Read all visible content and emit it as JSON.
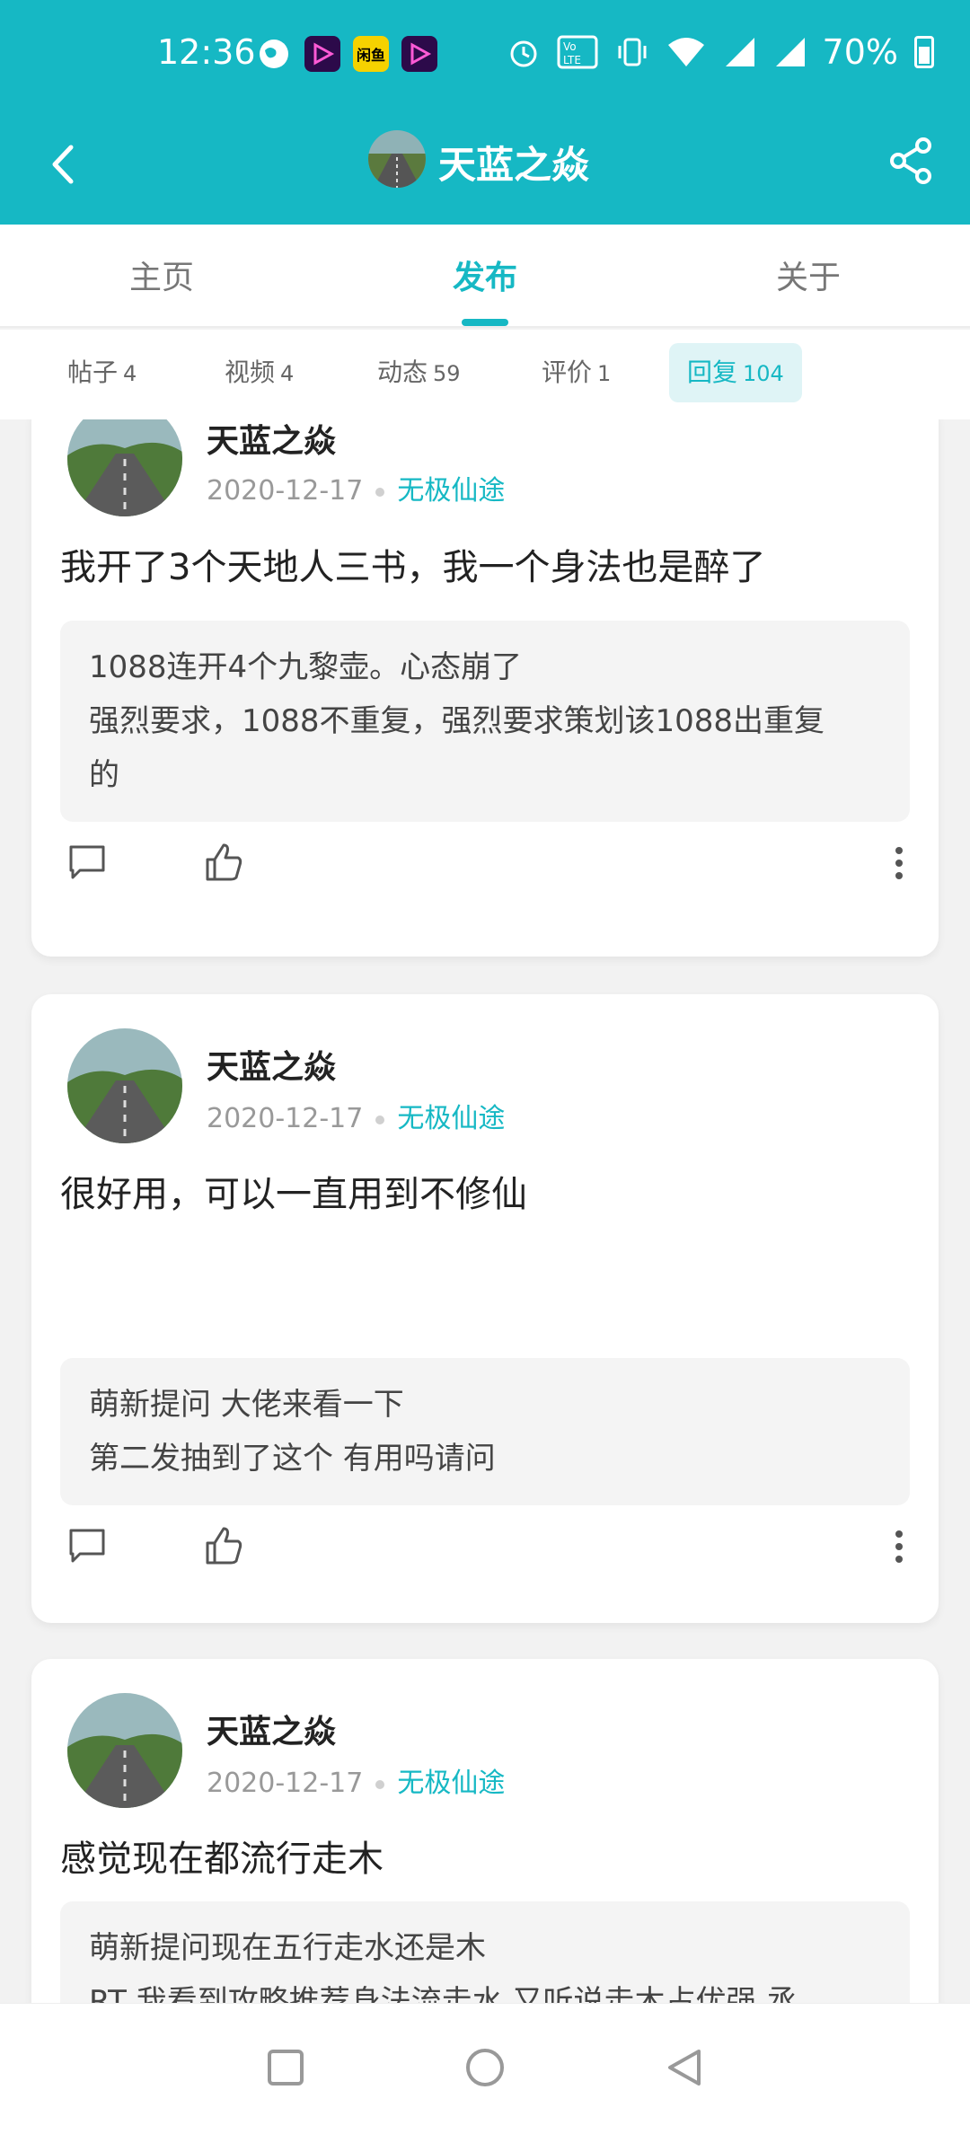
{
  "status_bar": {
    "time": "12:36",
    "battery": "70%",
    "notification_icons": [
      "globe-icon",
      "app-icon",
      "app-icon",
      "app-icon"
    ],
    "app2_label": "闲鱼",
    "system_icons": [
      "alarm-icon",
      "volte-icon",
      "vibrate-icon",
      "wifi-icon",
      "signal-icon",
      "signal-icon",
      "battery-icon"
    ]
  },
  "header": {
    "title": "天蓝之焱",
    "back_icon": "chevron-left-icon",
    "share_icon": "share-icon"
  },
  "tabs": [
    {
      "label": "主页",
      "active": false
    },
    {
      "label": "发布",
      "active": true
    },
    {
      "label": "关于",
      "active": false
    }
  ],
  "subtabs": [
    {
      "label": "帖子",
      "count": "4",
      "active": false
    },
    {
      "label": "视频",
      "count": "4",
      "active": false
    },
    {
      "label": "动态",
      "count": "59",
      "active": false
    },
    {
      "label": "评价",
      "count": "1",
      "active": false
    },
    {
      "label": "回复",
      "count": "104",
      "active": true
    }
  ],
  "posts": [
    {
      "author": "天蓝之焱",
      "date": "2020-12-17",
      "game": "无极仙途",
      "content": "我开了3个天地人三书，我一个身法也是醉了",
      "quote_lines": [
        "1088连开4个九黎壶。心态崩了",
        "强烈要求，1088不重复，强烈要求策划该1088出重复",
        "的"
      ]
    },
    {
      "author": "天蓝之焱",
      "date": "2020-12-17",
      "game": "无极仙途",
      "content": "很好用，可以一直用到不修仙",
      "quote_lines": [
        "萌新提问 大佬来看一下",
        "第二发抽到了这个 有用吗请问"
      ]
    },
    {
      "author": "天蓝之焱",
      "date": "2020-12-17",
      "game": "无极仙途",
      "content": "感觉现在都流行走木",
      "quote_lines": [
        "萌新提问现在五行走水还是木",
        "RT 我看到攻略推荐身法流走水 又听说走木占优强 丞"
      ]
    }
  ],
  "colors": {
    "accent": "#16b8c4",
    "background": "#f2f2f2"
  }
}
